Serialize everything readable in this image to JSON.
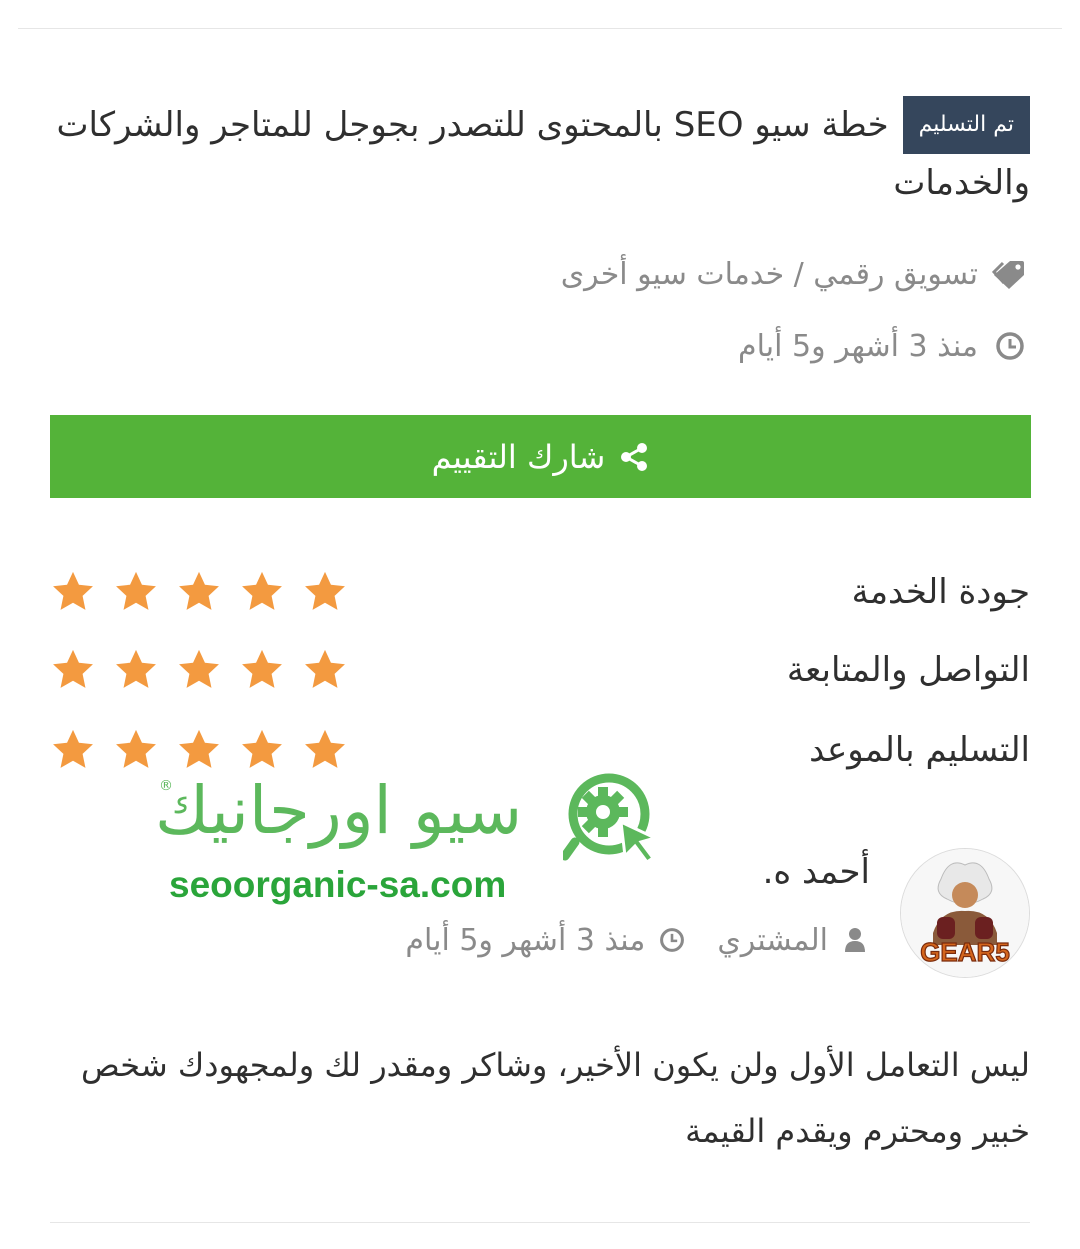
{
  "order": {
    "status_badge": "تم التسليم",
    "title": "خطة سيو SEO بالمحتوى للتصدر بجوجل للمتاجر والشركات والخدمات",
    "categories": "تسويق رقمي / خدمات سيو أخرى",
    "date": "منذ 3 أشهر و5 أيام"
  },
  "share_button": {
    "label": "شارك التقييم",
    "color": "#54b339"
  },
  "ratings": [
    {
      "label": "جودة الخدمة",
      "stars": 5
    },
    {
      "label": "التواصل والمتابعة",
      "stars": 5
    },
    {
      "label": "التسليم بالموعد",
      "stars": 5
    }
  ],
  "watermark": {
    "arabic": "سيو اورجانيك",
    "url": "seoorganic-sa.com",
    "reg_mark": "®",
    "color": "#5cb85c"
  },
  "reviewer": {
    "name": "أحمد ه.",
    "role": "المشتري",
    "date": "منذ 3 أشهر و5 أيام",
    "avatar_text": "GEAR5"
  },
  "review": {
    "text": "ليس التعامل الأول ولن يكون الأخير، وشاكر ومقدر لك ولمجهودك شخص خبير ومحترم ويقدم القيمة"
  },
  "colors": {
    "star": "#f39a40",
    "badge_bg": "#35465c",
    "muted": "#8a8a8a"
  }
}
